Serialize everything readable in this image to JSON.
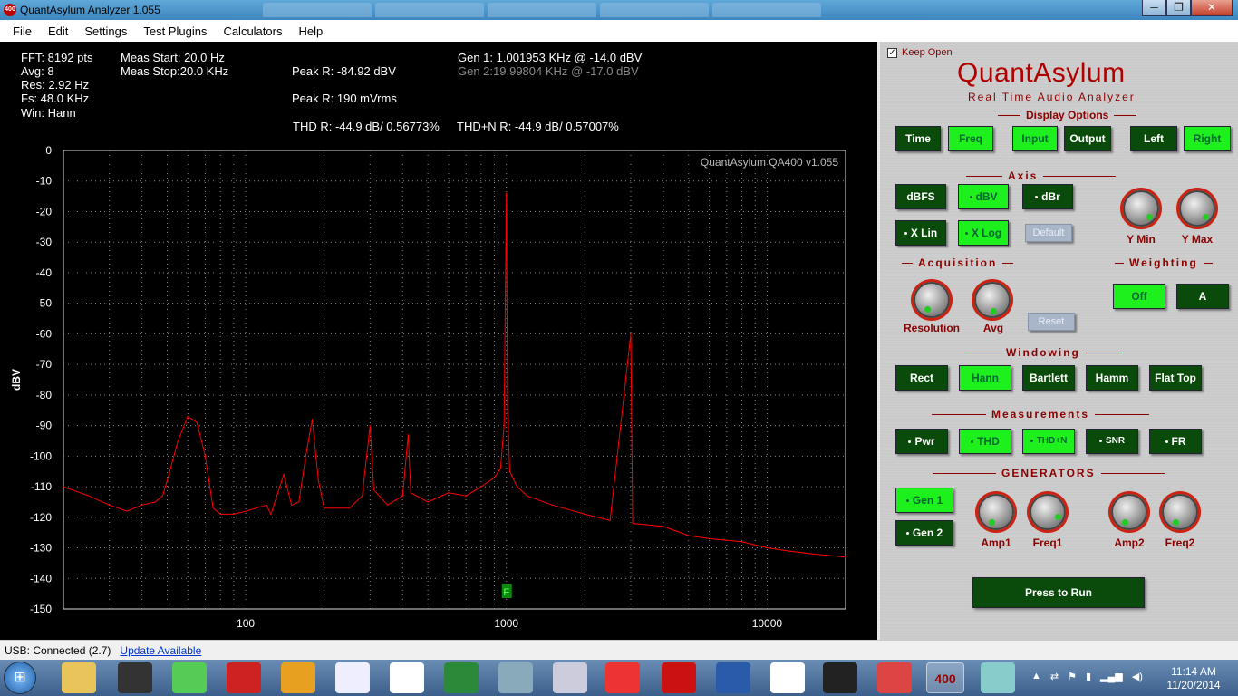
{
  "window": {
    "title": "QuantAsylum Analyzer 1.055",
    "min": "─",
    "max": "❐",
    "close": "✕"
  },
  "menu": [
    "File",
    "Edit",
    "Settings",
    "Test Plugins",
    "Calculators",
    "Help"
  ],
  "info": {
    "fft": "FFT: 8192 pts",
    "avg": "Avg: 8",
    "res": "Res: 2.92 Hz",
    "fs": "Fs: 48.0 KHz",
    "win": "Win: Hann",
    "meas_start": "Meas Start: 20.0 Hz",
    "meas_stop": "Meas Stop:20.0 KHz",
    "peak_r_dbv": "Peak R: -84.92 dBV",
    "peak_r_mv": "Peak R: 190 mVrms",
    "gen1": "Gen 1: 1.001953 KHz @ -14.0  dBV",
    "gen2": "Gen 2:19.99804 KHz @ -17.0  dBV",
    "thd": "THD R: -44.9 dB/ 0.56773%",
    "thdn": "THD+N R: -44.9 dB/ 0.57007%"
  },
  "chart_data": {
    "type": "line",
    "watermark": "QuantAsylum QA400 v1.055",
    "ylabel": "dBV",
    "xlabel": "",
    "x_scale": "log",
    "xlim": [
      20,
      20000
    ],
    "ylim": [
      -150,
      0
    ],
    "y_ticks": [
      "0",
      "-10",
      "-20",
      "-30",
      "-40",
      "-50",
      "-60",
      "-70",
      "-80",
      "-90",
      "-100",
      "-110",
      "-120",
      "-130",
      "-140",
      "-150"
    ],
    "x_ticks": [
      "100",
      "1000",
      "10000"
    ],
    "grid": true,
    "marker_label": "F",
    "series_color": "#ff0000",
    "series": [
      {
        "values_note_free": true,
        "points": [
          [
            20,
            -110
          ],
          [
            25,
            -113
          ],
          [
            30,
            -116
          ],
          [
            35,
            -118
          ],
          [
            40,
            -116
          ],
          [
            45,
            -115
          ],
          [
            48,
            -113
          ],
          [
            50,
            -108
          ],
          [
            55,
            -95
          ],
          [
            60,
            -87
          ],
          [
            65,
            -89
          ],
          [
            70,
            -100
          ],
          [
            75,
            -117
          ],
          [
            80,
            -119
          ],
          [
            90,
            -119
          ],
          [
            100,
            -118
          ],
          [
            110,
            -117
          ],
          [
            120,
            -116
          ],
          [
            125,
            -119
          ],
          [
            140,
            -106
          ],
          [
            150,
            -116
          ],
          [
            160,
            -115
          ],
          [
            170,
            -100
          ],
          [
            180,
            -88
          ],
          [
            190,
            -108
          ],
          [
            200,
            -117
          ],
          [
            250,
            -117
          ],
          [
            280,
            -113
          ],
          [
            300,
            -90
          ],
          [
            310,
            -111
          ],
          [
            350,
            -116
          ],
          [
            400,
            -113
          ],
          [
            420,
            -93
          ],
          [
            430,
            -112
          ],
          [
            500,
            -115
          ],
          [
            600,
            -112
          ],
          [
            700,
            -113
          ],
          [
            800,
            -110
          ],
          [
            900,
            -107
          ],
          [
            950,
            -104
          ],
          [
            980,
            -90
          ],
          [
            1000,
            -14
          ],
          [
            1010,
            -85
          ],
          [
            1030,
            -105
          ],
          [
            1100,
            -110
          ],
          [
            1200,
            -113
          ],
          [
            1500,
            -116
          ],
          [
            2000,
            -119
          ],
          [
            2500,
            -121
          ],
          [
            3000,
            -60
          ],
          [
            3050,
            -122
          ],
          [
            4000,
            -123
          ],
          [
            5000,
            -126
          ],
          [
            6000,
            -127
          ],
          [
            8000,
            -128
          ],
          [
            10000,
            -130
          ],
          [
            12000,
            -131
          ],
          [
            15000,
            -132
          ],
          [
            20000,
            -133
          ]
        ]
      }
    ]
  },
  "panel": {
    "keep_open": "Keep Open",
    "keep_open_mark": "✓",
    "brand": "QuantAsylum",
    "subbrand": "Real Time Audio Analyzer",
    "display_options": "Display Options",
    "display_buttons": [
      "Time",
      "Freq",
      "Input",
      "Output",
      "Left",
      "Right"
    ],
    "axis": "Axis",
    "axis_buttons": [
      "dBFS",
      "dBV",
      "dBr",
      "X Lin",
      "X Log",
      "Default"
    ],
    "ymin": "Y Min",
    "ymax": "Y Max",
    "acquisition": "Acquisition",
    "resolution": "Resolution",
    "avg": "Avg",
    "reset": "Reset",
    "weighting": "Weighting",
    "weight_buttons": [
      "Off",
      "A"
    ],
    "windowing": "Windowing",
    "window_buttons": [
      "Rect",
      "Hann",
      "Bartlett",
      "Hamm",
      "Flat Top"
    ],
    "measurements": "Measurements",
    "meas_buttons": [
      "Pwr",
      "THD",
      "THD+N",
      "SNR",
      "FR"
    ],
    "generators": "GENERATORS",
    "gen1": "Gen 1",
    "gen2": "Gen 2",
    "amp1": "Amp1",
    "freq1": "Freq1",
    "amp2": "Amp2",
    "freq2": "Freq2",
    "run": "Press to Run"
  },
  "status": {
    "usb": "USB: Connected  (2.7)",
    "update": "Update Available"
  },
  "taskbar": {
    "start_icon": "windows-start-icon",
    "time": "11:14 AM",
    "date": "11/20/2014",
    "apps": [
      "folder",
      "fan",
      "circuit",
      "ltspice",
      "audio",
      "lv",
      "cursor",
      "excel",
      "board",
      "calculator",
      "chrome",
      "acrobat",
      "word",
      "fox",
      "crop",
      "media",
      "qa400",
      "paint"
    ],
    "qa400_label": "400"
  }
}
